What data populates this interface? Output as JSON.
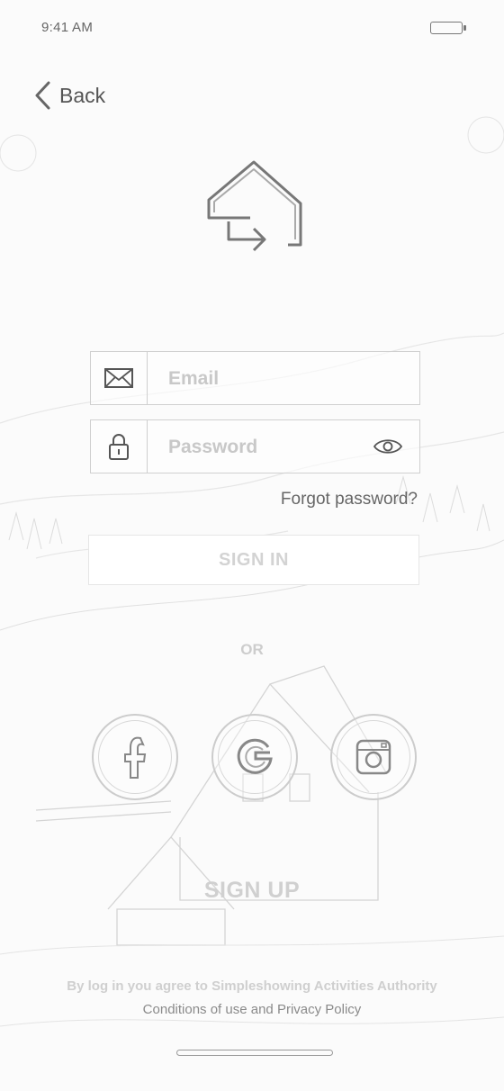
{
  "status_bar": {
    "time": "9:41 AM"
  },
  "nav": {
    "back_label": "Back"
  },
  "form": {
    "email_placeholder": "Email",
    "password_placeholder": "Password",
    "forgot_label": "Forgot password?",
    "signin_label": "SIGN IN"
  },
  "divider": {
    "or_label": "OR"
  },
  "social": [
    {
      "name": "facebook",
      "icon": "facebook-icon"
    },
    {
      "name": "google",
      "icon": "google-icon"
    },
    {
      "name": "instagram",
      "icon": "instagram-icon"
    }
  ],
  "signup_label": "SIGN UP",
  "footer": {
    "agreement": "By log in you agree to Simpleshowing Activities Authority",
    "conditions_label": "Conditions of use",
    "and_label": "and",
    "privacy_label": "Privacy Policy"
  }
}
